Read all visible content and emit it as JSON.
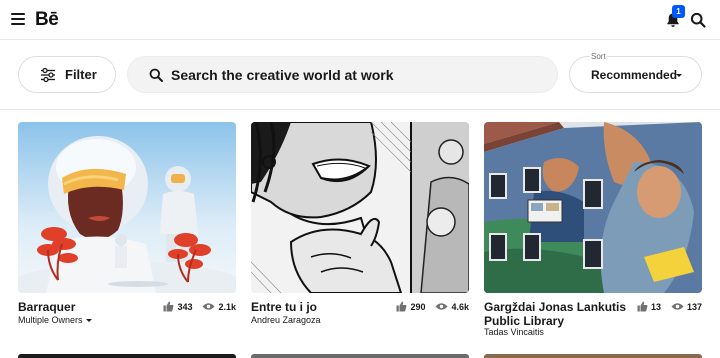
{
  "header": {
    "logo": "Bē",
    "notification_count": "1"
  },
  "filters": {
    "filter_label": "Filter",
    "search_placeholder": "Search the creative world at work",
    "sort_caption": "Sort",
    "sort_value": "Recommended"
  },
  "projects": [
    {
      "title": "Barraquer",
      "owner": "Multiple Owners",
      "appreciations": "343",
      "views": "2.1k"
    },
    {
      "title": "Entre tu i jo",
      "owner": "Andreu Zaragoza",
      "appreciations": "290",
      "views": "4.6k"
    },
    {
      "title_line1": "Gargždai Jonas Lankutis",
      "title_line2": "Public Library",
      "owner": "Tadas Vincaitis",
      "appreciations": "13",
      "views": "137"
    }
  ],
  "icons": {
    "menu": "hamburger-menu-icon",
    "notifications": "bell-icon",
    "search": "search-icon",
    "filter": "sliders-icon",
    "appreciations": "thumbs-up-icon",
    "views": "eye-icon"
  }
}
